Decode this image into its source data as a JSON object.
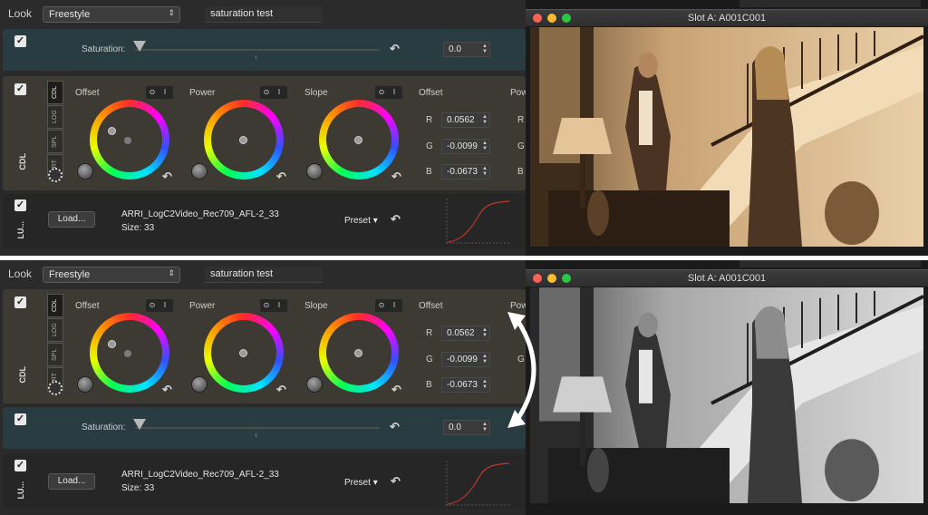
{
  "panels": [
    {
      "look_label": "Look",
      "look_select": "Freestyle",
      "look_name": "saturation test",
      "saturation": {
        "label": "Saturation:",
        "value": "0.0"
      },
      "cdl": {
        "tabs": [
          "CDL",
          "LOG",
          "SPL",
          "PRT"
        ],
        "side_label": "CDL",
        "wheels": [
          {
            "label": "Offset",
            "btn1": "⊙",
            "btn2": "I"
          },
          {
            "label": "Power",
            "btn1": "⊙",
            "btn2": "I"
          },
          {
            "label": "Slope",
            "btn1": "⊙",
            "btn2": "I"
          }
        ],
        "values_title": "Offset",
        "values_title_cut": "Pow",
        "values": [
          {
            "channel": "R",
            "value": "0.0562"
          },
          {
            "channel": "G",
            "value": "-0.0099"
          },
          {
            "channel": "B",
            "value": "-0.0673"
          }
        ]
      },
      "lut": {
        "load_label": "Load...",
        "name": "ARRI_LogC2Video_Rec709_AFL-2_33",
        "size": "Size: 33",
        "preset": "Preset",
        "side_label": "LU..."
      },
      "viewer": {
        "title": "Slot A: A001C001",
        "tint": "sepia"
      }
    },
    {
      "look_label": "Look",
      "look_select": "Freestyle",
      "look_name": "saturation test",
      "saturation": {
        "label": "Saturation:",
        "value": "0.0"
      },
      "cdl": {
        "tabs": [
          "CDL",
          "LOG",
          "SPL",
          "PRT"
        ],
        "side_label": "CDL",
        "wheels": [
          {
            "label": "Offset",
            "btn1": "⊙",
            "btn2": "I"
          },
          {
            "label": "Power",
            "btn1": "⊙",
            "btn2": "I"
          },
          {
            "label": "Slope",
            "btn1": "⊙",
            "btn2": "I"
          }
        ],
        "values_title": "Offset",
        "values_title_cut": "Pow",
        "values": [
          {
            "channel": "R",
            "value": "0.0562"
          },
          {
            "channel": "G",
            "value": "-0.0099"
          },
          {
            "channel": "B",
            "value": "-0.0673"
          }
        ]
      },
      "lut": {
        "load_label": "Load...",
        "name": "ARRI_LogC2Video_Rec709_AFL-2_33",
        "size": "Size: 33",
        "preset": "Preset",
        "side_label": "LU..."
      },
      "viewer": {
        "title": "Slot A: A001C001",
        "tint": "grayscale"
      }
    }
  ],
  "colors": {
    "saturation_bg": "#283c42",
    "cdl_bg": "#3d3a33",
    "accent_close": "#fe5f57",
    "accent_min": "#febc2e",
    "accent_max": "#28c840"
  },
  "annotation": {
    "icon": "double-headed-arrow-icon"
  }
}
